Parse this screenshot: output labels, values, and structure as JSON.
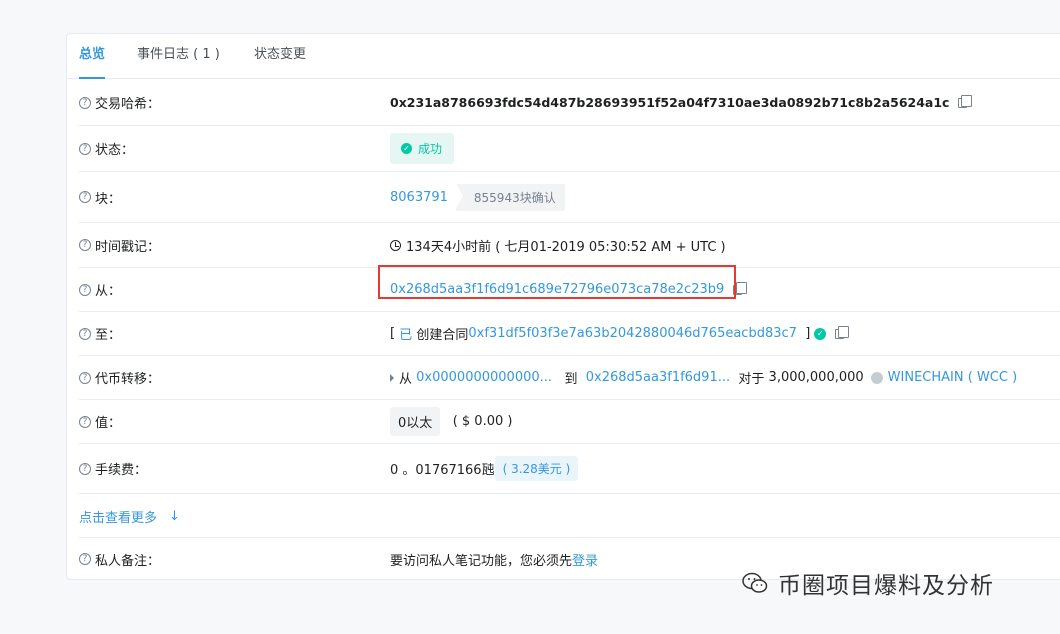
{
  "tabs": [
    {
      "label": "总览"
    },
    {
      "label": "事件日志 ( 1 )"
    },
    {
      "label": "状态变更"
    }
  ],
  "rows": {
    "hash": {
      "label": "交易哈希：",
      "value": "0x231a8786693fdc54d487b28693951f52a04f7310ae3da0892b71c8b2a5624a1c"
    },
    "status": {
      "label": "状态：",
      "value": "成功"
    },
    "block": {
      "label": "块：",
      "number": "8063791",
      "confirmations": "855943块确认"
    },
    "timestamp": {
      "label": "时间戳记：",
      "value": "134天4小时前 ( 七月01-2019 05:30:52 AM + UTC )"
    },
    "from": {
      "label": "从：",
      "value": "0x268d5aa3f1f6d91c689e72796e073ca78e2c23b9"
    },
    "to": {
      "label": "至：",
      "prefix": "[",
      "created": "已",
      "created_text": "创建合同",
      "contract": "0xf31df5f03f3e7a63b2042880046d765eacbd83c7",
      "suffix": "]"
    },
    "transfer": {
      "label": "代币转移：",
      "from_word": "从",
      "from_addr": "0x0000000000000...",
      "to_word": "到",
      "to_addr": "0x268d5aa3f1f6d91...",
      "for_word": "对于",
      "amount": "3,000,000,000",
      "token": "WINECHAIN ( WCC )"
    },
    "value": {
      "label": "值：",
      "eth": "0以太",
      "usd": "( $ 0.00 )"
    },
    "fee": {
      "label": "手续费：",
      "value": "0 。01767166瓲",
      "usd": "( 3.28美元 )"
    },
    "note": {
      "label": "私人备注：",
      "text": "要访问私人笔记功能，您必须先",
      "login": "登录"
    }
  },
  "more": {
    "label": "点击查看更多"
  },
  "watermark": {
    "text": "币圈项目爆料及分析"
  },
  "colors": {
    "accent": "#3498db",
    "success": "#00c9a7",
    "highlight": "#e53935"
  }
}
